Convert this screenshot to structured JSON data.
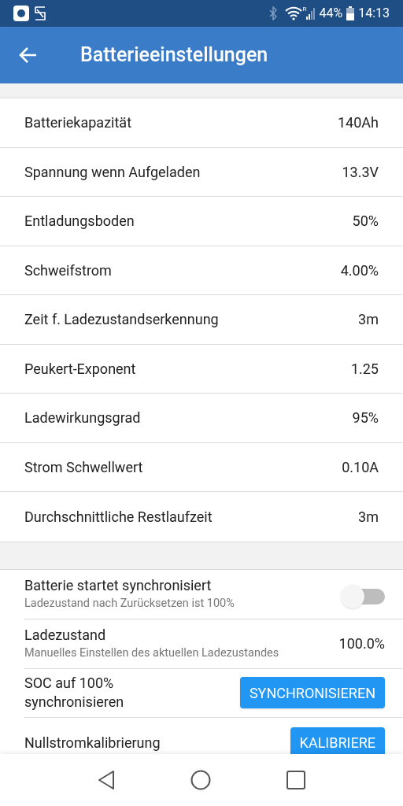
{
  "status_bar": {
    "battery": "44%",
    "time": "14:13",
    "roaming": "R"
  },
  "app_bar": {
    "title": "Batterieeinstellungen"
  },
  "settings": [
    {
      "label": "Batteriekapazität",
      "value": "140Ah"
    },
    {
      "label": "Spannung wenn Aufgeladen",
      "value": "13.3V"
    },
    {
      "label": "Entladungsboden",
      "value": "50%"
    },
    {
      "label": "Schweifstrom",
      "value": "4.00%"
    },
    {
      "label": "Zeit f. Ladezustandserkennung",
      "value": "3m"
    },
    {
      "label": "Peukert-Exponent",
      "value": "1.25"
    },
    {
      "label": "Ladewirkungsgrad",
      "value": "95%"
    },
    {
      "label": "Strom Schwellwert",
      "value": "0.10A"
    },
    {
      "label": "Durchschnittliche Restlaufzeit",
      "value": "3m"
    }
  ],
  "actions": [
    {
      "kind": "toggle",
      "label": "Batterie startet synchronisiert",
      "description": "Ladezustand nach Zurücksetzen ist 100%",
      "on": false
    },
    {
      "kind": "value",
      "label": "Ladezustand",
      "description": "Manuelles Einstellen des aktuellen Ladezustandes",
      "value": "100.0%"
    },
    {
      "kind": "button",
      "label": "SOC auf 100% synchronisieren",
      "button": "SYNCHRONISIEREN"
    },
    {
      "kind": "button",
      "label": "Nullstromkalibrierung",
      "button": "KALIBRIERE"
    }
  ]
}
